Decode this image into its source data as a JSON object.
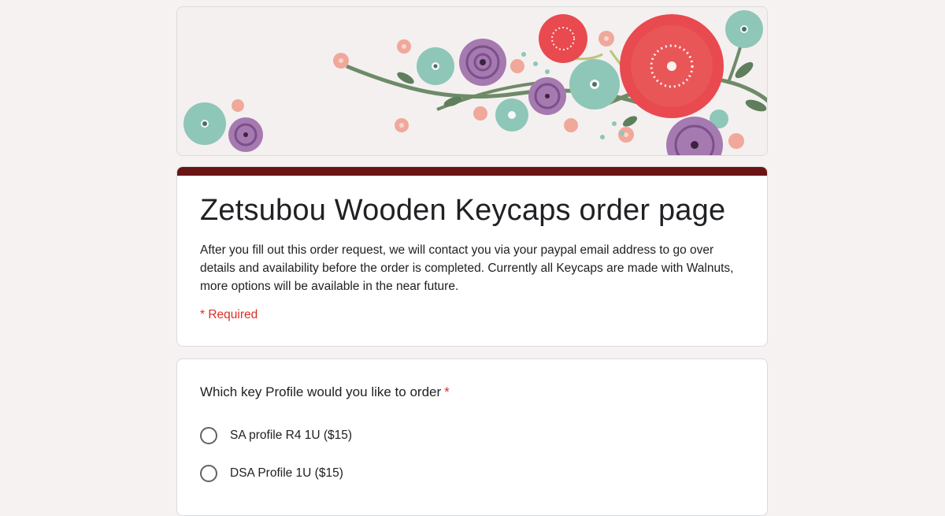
{
  "header": {
    "image_name": "floral-banner",
    "colors": {
      "red": "#e84a4f",
      "teal": "#8ec6b8",
      "purple": "#a57ab0",
      "peach": "#f0a89a",
      "stem": "#5f7f5c",
      "background": "#f4f0f0"
    }
  },
  "theme": {
    "accent": "#6a1414",
    "required": "#d93025",
    "page_background": "#f6f2f1"
  },
  "form": {
    "title": "Zetsubou Wooden Keycaps order page",
    "description": "After you fill out this order request, we will contact you via your paypal email address to go over details and availability before the order is completed. Currently all Keycaps are made with Walnuts, more options will be available in the near future.",
    "required_note": "* Required"
  },
  "question": {
    "title": "Which key Profile would you like to order",
    "required_marker": "*",
    "options": [
      {
        "label": "SA profile R4 1U ($15)"
      },
      {
        "label": "DSA Profile 1U ($15)"
      }
    ]
  }
}
